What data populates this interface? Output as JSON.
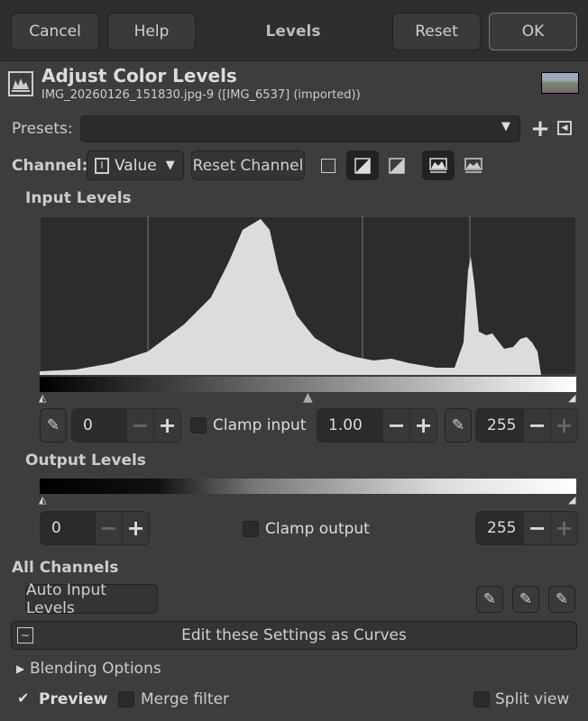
{
  "header": {
    "cancel": "Cancel",
    "help": "Help",
    "title": "Levels",
    "reset": "Reset",
    "ok": "OK"
  },
  "dialog": {
    "title": "Adjust Color Levels",
    "subtitle": "IMG_20260126_151830.jpg-9 ([IMG_6537] (imported))"
  },
  "presets": {
    "label": "Presets:",
    "value": ""
  },
  "channel": {
    "label": "Channel:",
    "value": "Value",
    "reset": "Reset Channel"
  },
  "input_levels": {
    "heading": "Input Levels",
    "low": "0",
    "gamma": "1.00",
    "high": "255",
    "clamp": "Clamp input",
    "clamp_checked": false
  },
  "output_levels": {
    "heading": "Output Levels",
    "low": "0",
    "high": "255",
    "clamp": "Clamp output",
    "clamp_checked": false
  },
  "all_channels": {
    "heading": "All Channels",
    "auto": "Auto Input Levels"
  },
  "curves_button": "Edit these Settings as Curves",
  "blending": "Blending Options",
  "footer": {
    "preview": "Preview",
    "preview_checked": true,
    "merge": "Merge filter",
    "split": "Split view"
  }
}
